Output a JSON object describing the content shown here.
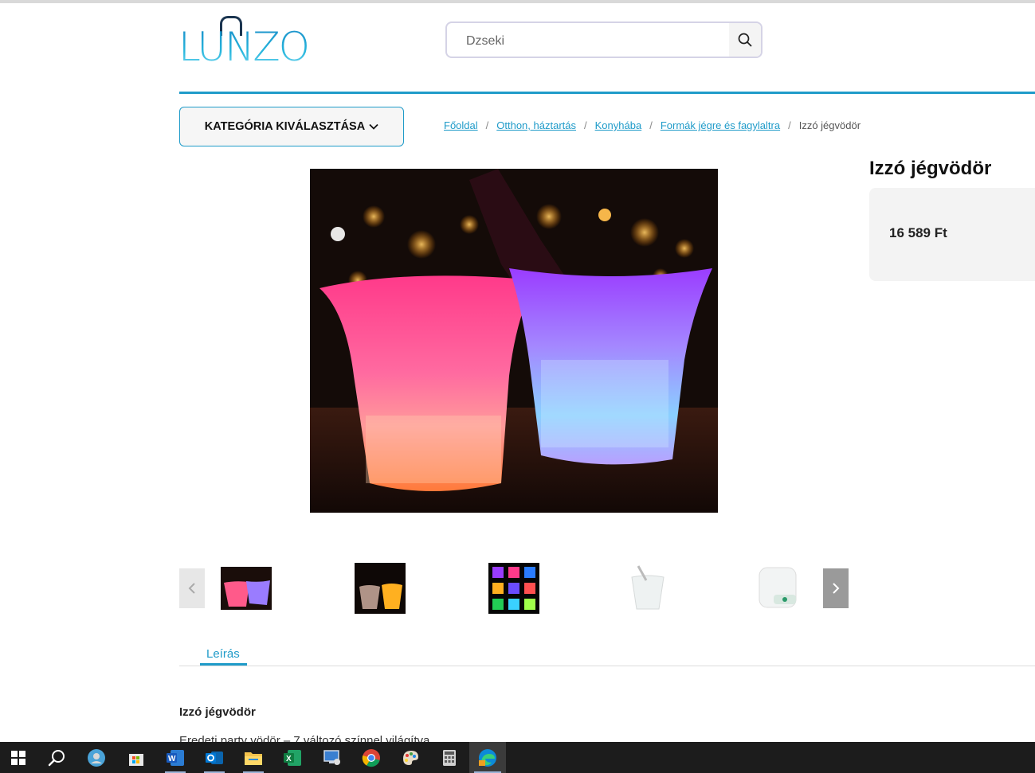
{
  "header": {
    "logo_text": "LUNZO",
    "search": {
      "value": "",
      "placeholder": "Dzseki"
    }
  },
  "category_button": {
    "label": "KATEGÓRIA KIVÁLASZTÁSA"
  },
  "breadcrumb": {
    "items": [
      {
        "label": "Főoldal",
        "link": true
      },
      {
        "label": "Otthon, háztartás",
        "link": true
      },
      {
        "label": "Konyhába",
        "link": true
      },
      {
        "label": "Formák jégre és fagylaltra",
        "link": true
      },
      {
        "label": "Izzó jégvödör",
        "link": false
      }
    ],
    "separator": "/"
  },
  "product": {
    "title": "Izzó jégvödör",
    "price": "16 589 Ft"
  },
  "thumbnails": {
    "count": 5,
    "icons": [
      "chevron-left-icon",
      "chevron-right-icon"
    ]
  },
  "tabs": [
    {
      "label": "Leírás",
      "active": true
    }
  ],
  "description": {
    "title": "Izzó jégvödör",
    "text": "Eredeti party vödör – 7 változó színnel világítva"
  },
  "taskbar": {
    "apps": [
      "start",
      "search",
      "cortana",
      "store",
      "word",
      "outlook",
      "file-explorer",
      "excel",
      "remote-desktop",
      "chrome",
      "paint",
      "calculator",
      "edge"
    ],
    "active_app": "edge"
  },
  "colors": {
    "accent": "#1f9bc9",
    "price_box_bg": "#f3f3f3",
    "taskbar_bg": "#1c1c1c"
  }
}
